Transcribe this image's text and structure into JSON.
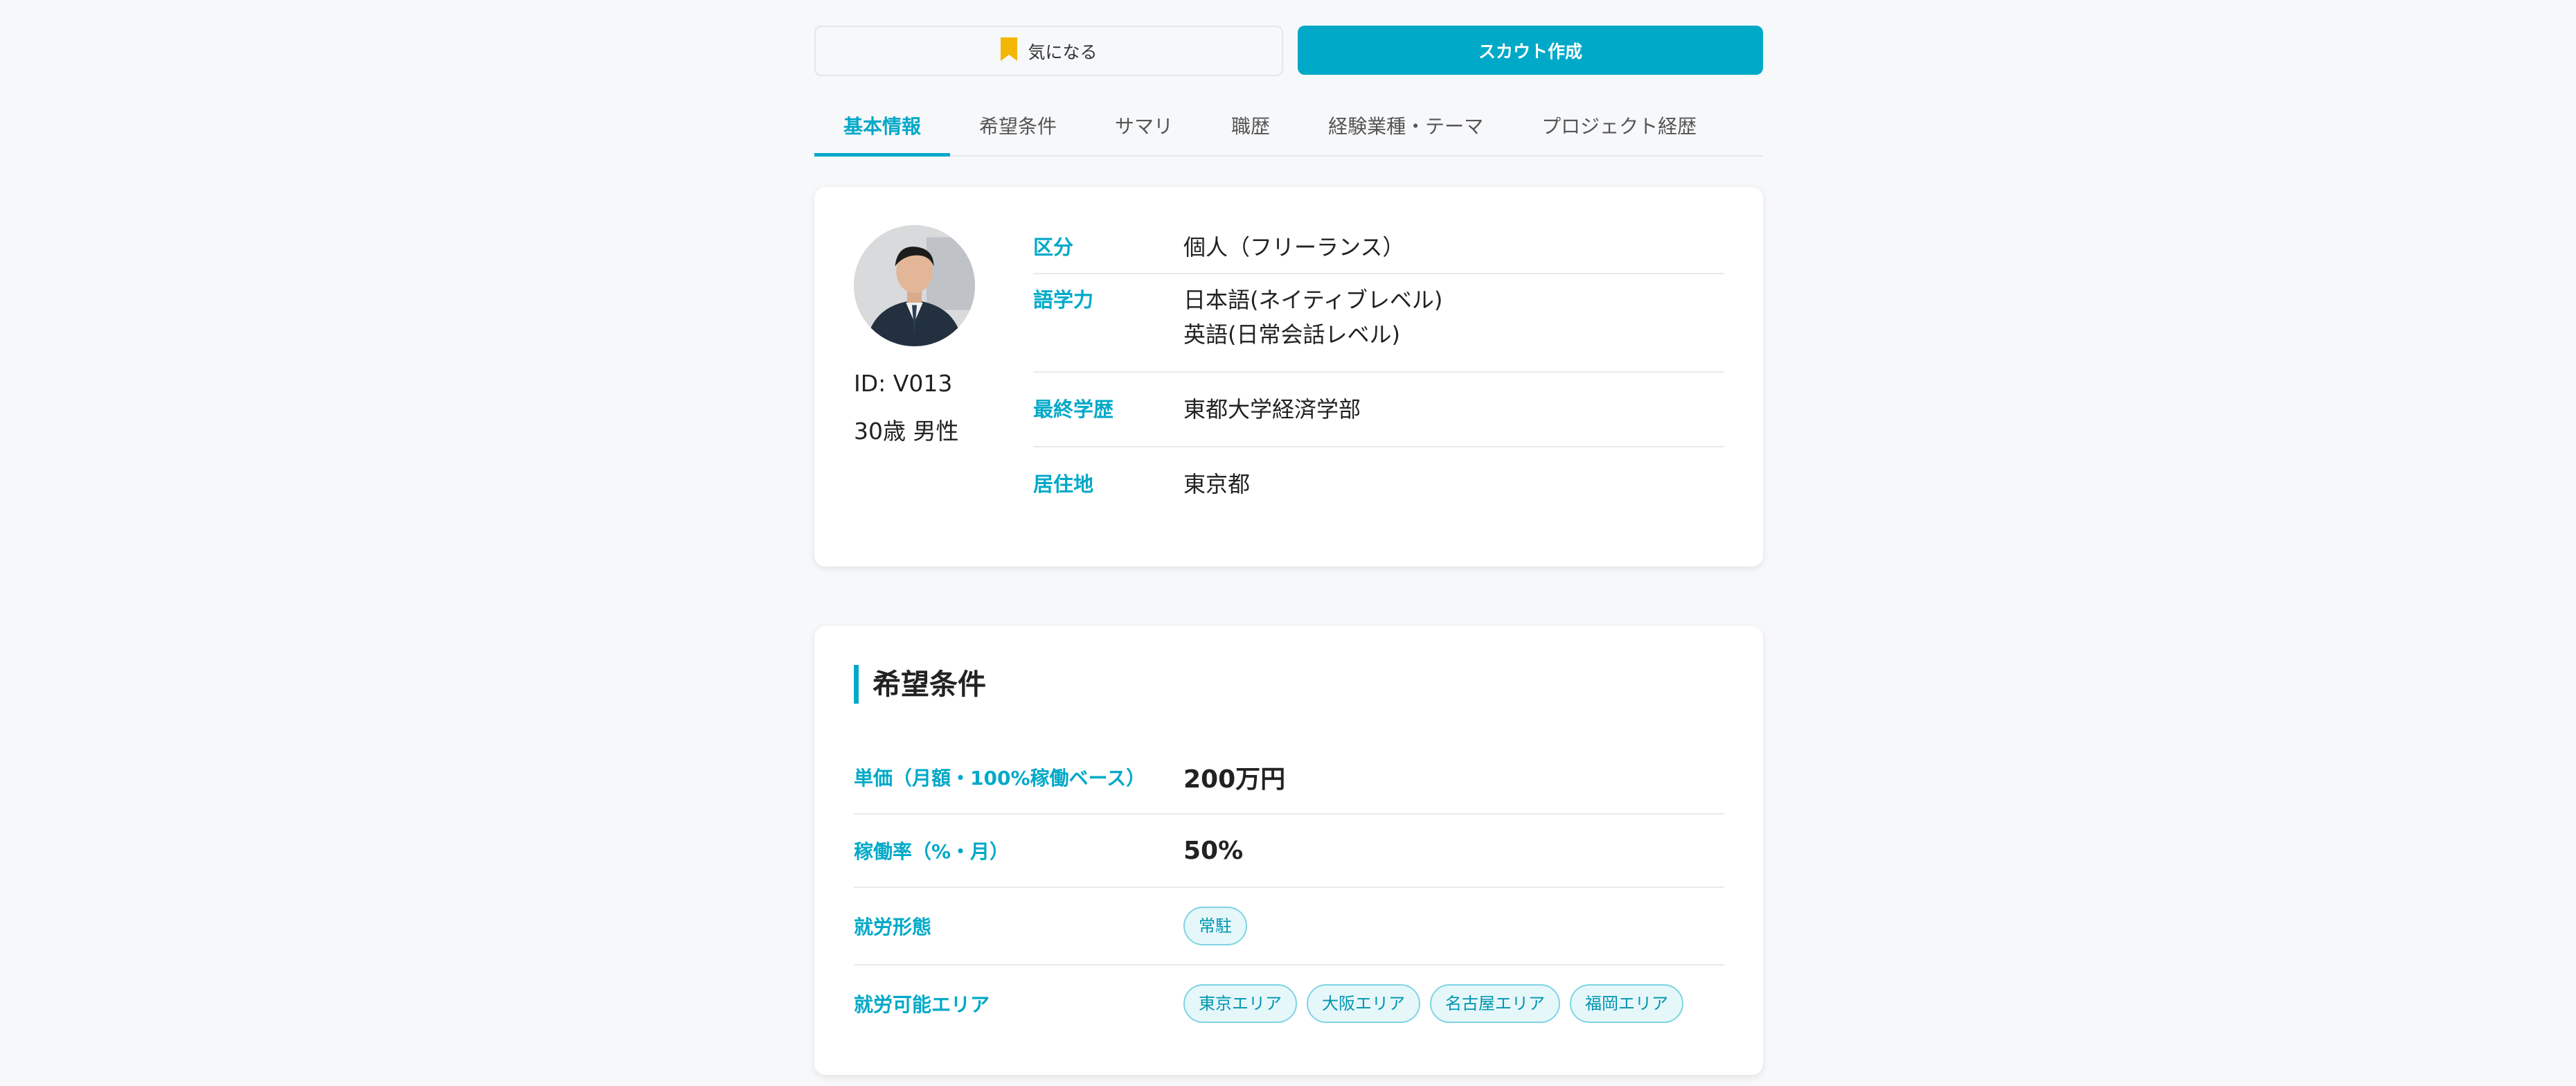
{
  "actions": {
    "favorite_label": "気になる",
    "scout_label": "スカウト作成",
    "favorite_icon": "bookmark-icon",
    "favorite_icon_color": "#f2b705",
    "accent_color": "#00a9c8"
  },
  "tabs": [
    {
      "label": "基本情報",
      "active": true
    },
    {
      "label": "希望条件",
      "active": false
    },
    {
      "label": "サマリ",
      "active": false
    },
    {
      "label": "職歴",
      "active": false
    },
    {
      "label": "経験業種・テーマ",
      "active": false
    },
    {
      "label": "プロジェクト経歴",
      "active": false
    }
  ],
  "profile": {
    "id": "ID: V013",
    "age_gender": "30歳 男性",
    "rows": [
      {
        "label": "区分",
        "values": [
          "個人（フリーランス）"
        ]
      },
      {
        "label": "語学力",
        "values": [
          "日本語(ネイティブレベル)",
          "英語(日常会話レベル)"
        ]
      },
      {
        "label": "最終学歴",
        "values": [
          "東都大学経済学部"
        ]
      },
      {
        "label": "居住地",
        "values": [
          "東京都"
        ]
      }
    ]
  },
  "preferences": {
    "title": "希望条件",
    "rate_label": "単価（月額・100%稼働ベース）",
    "rate_value": "200万円",
    "utilization_label": "稼働率（%・月）",
    "utilization_value": "50%",
    "work_style_label": "就労形態",
    "work_style_tags": [
      "常駐"
    ],
    "area_label": "就労可能エリア",
    "area_tags": [
      "東京エリア",
      "大阪エリア",
      "名古屋エリア",
      "福岡エリア"
    ]
  }
}
